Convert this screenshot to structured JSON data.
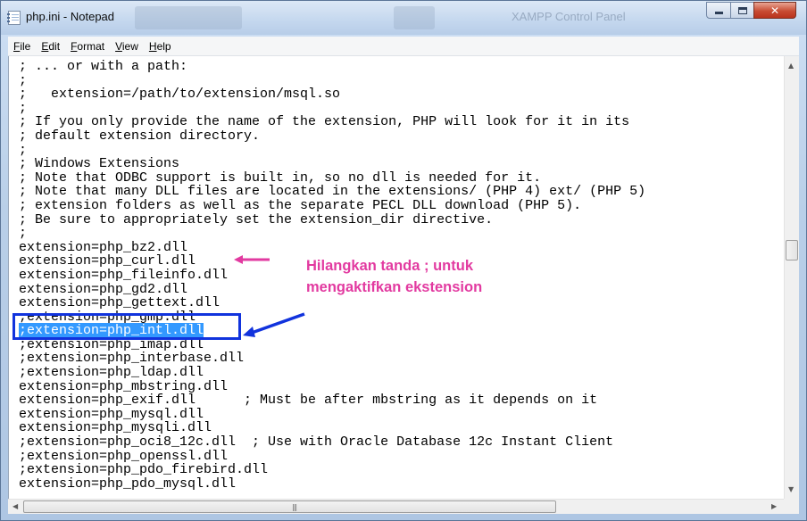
{
  "window": {
    "title": "php.ini - Notepad",
    "background_window_title": "XAMPP Control Panel"
  },
  "menu": [
    "File",
    "Edit",
    "Format",
    "View",
    "Help"
  ],
  "editor": {
    "lines": [
      "; ... or with a path:",
      ";",
      ";   extension=/path/to/extension/msql.so",
      ";",
      "; If you only provide the name of the extension, PHP will look for it in its",
      "; default extension directory.",
      ";",
      "; Windows Extensions",
      "; Note that ODBC support is built in, so no dll is needed for it.",
      "; Note that many DLL files are located in the extensions/ (PHP 4) ext/ (PHP 5)",
      "; extension folders as well as the separate PECL DLL download (PHP 5).",
      "; Be sure to appropriately set the extension_dir directive.",
      ";",
      "extension=php_bz2.dll",
      "extension=php_curl.dll",
      "extension=php_fileinfo.dll",
      "extension=php_gd2.dll",
      "extension=php_gettext.dll",
      ";extension=php_gmp.dll",
      ";extension=php_intl.dll",
      ";extension=php_imap.dll",
      ";extension=php_interbase.dll",
      ";extension=php_ldap.dll",
      "extension=php_mbstring.dll",
      "extension=php_exif.dll      ; Must be after mbstring as it depends on it",
      "extension=php_mysql.dll",
      "extension=php_mysqli.dll",
      ";extension=php_oci8_12c.dll  ; Use with Oracle Database 12c Instant Client",
      ";extension=php_openssl.dll",
      ";extension=php_pdo_firebird.dll",
      "extension=php_pdo_mysql.dll"
    ],
    "selected_line": 19
  },
  "annotation": {
    "text": "Hilangkan tanda ; untuk\nmengaktifkan ekstension",
    "text_color": "#e23aa0",
    "box_color": "#1133dd"
  },
  "colors": {
    "selection": "#3399ff",
    "close_button": "#c84c33"
  }
}
